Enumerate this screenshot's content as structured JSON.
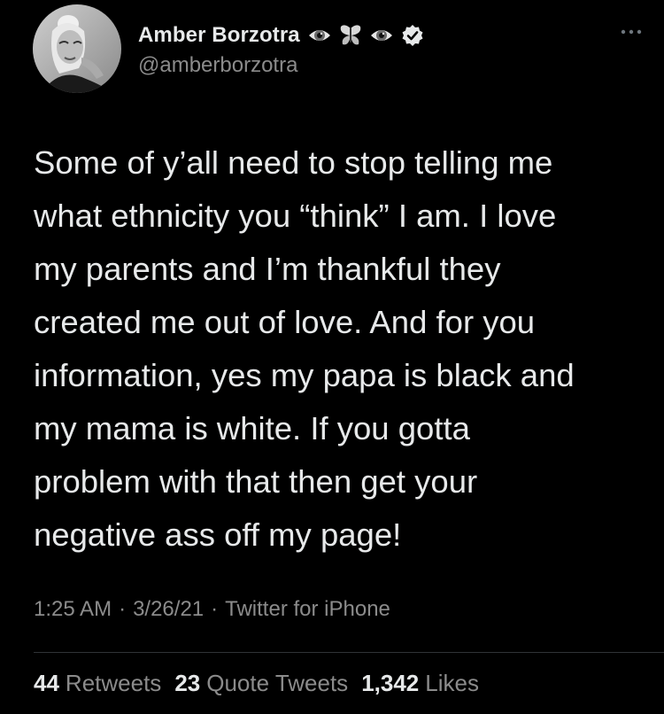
{
  "tweet": {
    "author": {
      "display_name": "Amber Borzotra",
      "handle": "@amberborzotra",
      "name_emojis": [
        "eye-emoji-icon",
        "butterfly-emoji-icon",
        "eye-emoji-icon"
      ],
      "verified": true
    },
    "text": "Some of y’all need to stop telling me\nwhat ethnicity you “think” I am. I love\nmy parents and I’m thankful they\ncreated me out of love. And for you\ninformation, yes my papa is black and\nmy mama is white. If you gotta\nproblem with that then get your\nnegative ass off my page!",
    "time": "1:25 AM",
    "date": "3/26/21",
    "source": "Twitter for iPhone",
    "separator": "·",
    "stats": {
      "retweets_count": "44",
      "retweets_label": "Retweets",
      "quote_tweets_count": "23",
      "quote_tweets_label": "Quote Tweets",
      "likes_count": "1,342",
      "likes_label": "Likes"
    }
  },
  "colors": {
    "background": "#000000",
    "primary_text": "#e7e9ea",
    "secondary_text": "#8b8b8b",
    "divider": "#2f3336"
  }
}
